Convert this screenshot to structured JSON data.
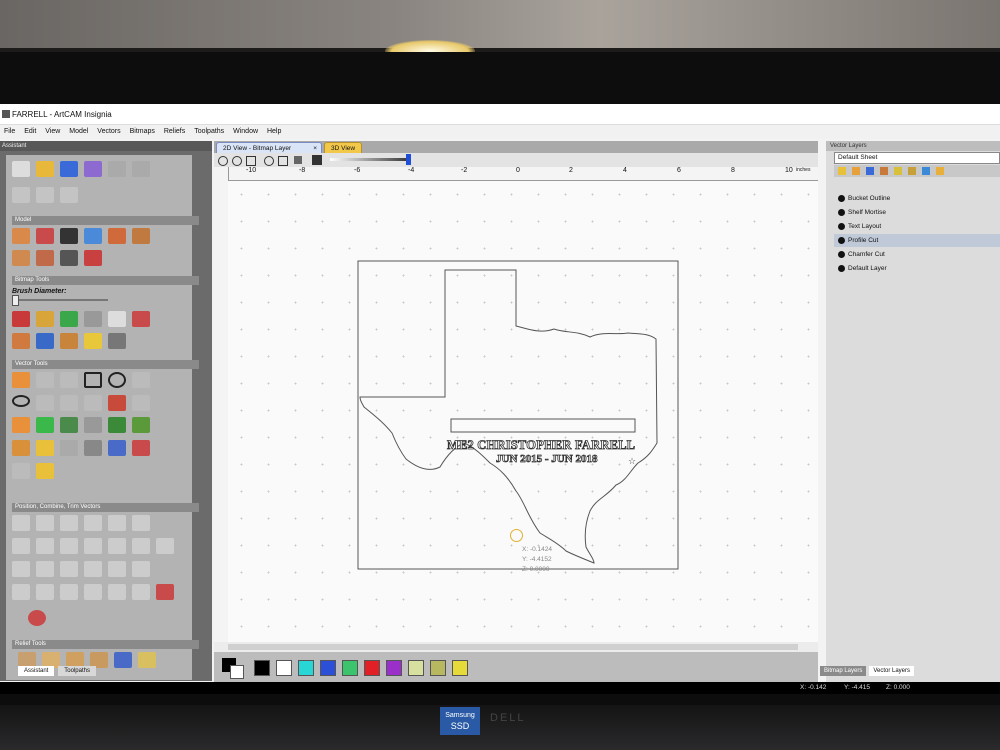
{
  "window": {
    "title": "FARRELL - ArtCAM Insignia"
  },
  "menu": [
    "File",
    "Edit",
    "View",
    "Model",
    "Vectors",
    "Bitmaps",
    "Reliefs",
    "Toolpaths",
    "Window",
    "Help"
  ],
  "assistant": {
    "title": "Assistant",
    "sections": {
      "model": "Model",
      "bitmap_tools": "Bitmap Tools",
      "brush_diameter": "Brush Diameter:",
      "vector_tools": "Vector Tools",
      "position": "Position, Combine, Trim Vectors",
      "relief_tools": "Relief Tools"
    },
    "tabs": [
      "Assistant",
      "Toolpaths"
    ]
  },
  "doc_tabs": [
    "2D View - Bitmap Layer",
    "3D View"
  ],
  "ruler": {
    "top": [
      "-10",
      "-8",
      "-6",
      "-4",
      "-2",
      "0",
      "2",
      "4",
      "6",
      "8",
      "10"
    ],
    "units": "inches"
  },
  "design": {
    "line1": "ME2 CHRISTOPHER FARRELL",
    "line2": "JUN 2015 - JUN 2018",
    "coords": {
      "x": "X: -0.1424",
      "y": "Y: -4.4152",
      "z": "Z: 0.0000"
    }
  },
  "palette": [
    "#000000",
    "#ffffff",
    "#29d6d6",
    "#2c4fd8",
    "#3cc46c",
    "#e01f27",
    "#9a2fc9",
    "#d8e0a0",
    "#b8b860",
    "#e6d93a"
  ],
  "vector_layers": {
    "title": "Vector Layers",
    "sheet": "Default Sheet",
    "layers": [
      "Bucket Outline",
      "Shelf Mortise",
      "Text Layout",
      "Profile Cut",
      "Chamfer Cut",
      "Default Layer"
    ],
    "selected": "Profile Cut"
  },
  "right_tabs": [
    "Bitmap Layers",
    "Vector Layers"
  ],
  "status": {
    "x": "X: -0.142",
    "y": "Y: -4.415",
    "z": "Z: 0.000"
  },
  "monitor": {
    "brand": "DELL",
    "badge_top": "Samsung",
    "badge_bottom": "SSD"
  }
}
